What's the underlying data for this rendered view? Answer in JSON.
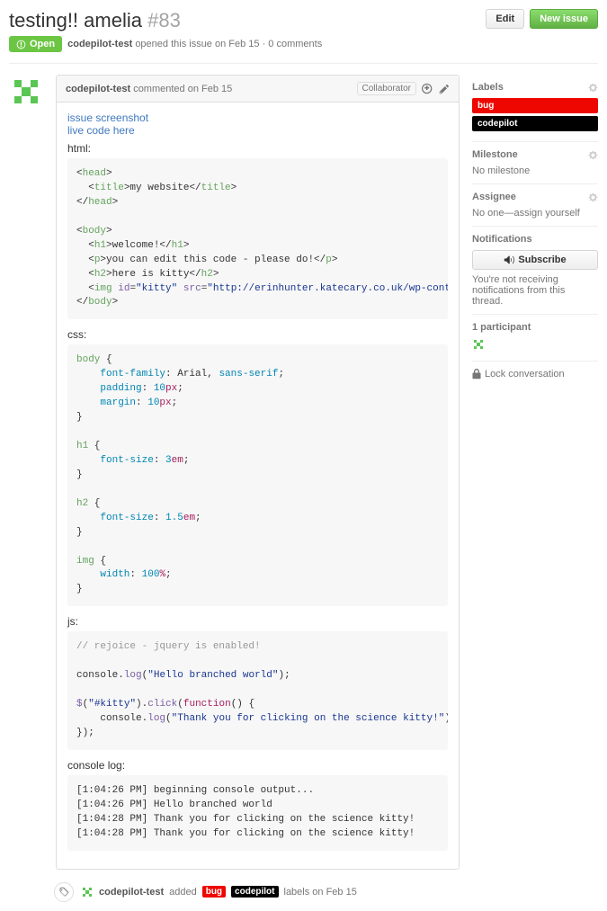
{
  "header": {
    "title": "testing!! amelia",
    "number": "#83",
    "edit": "Edit",
    "new_issue": "New issue",
    "state": "Open",
    "author": "codepilot-test",
    "opened_text": "opened this issue on Feb 15 · 0 comments"
  },
  "comment": {
    "author": "codepilot-test",
    "when": "commented on Feb 15",
    "collab": "Collaborator",
    "links": {
      "screenshot": "issue screenshot",
      "livecode": "live code here"
    },
    "labels": {
      "html": "html:",
      "css": "css:",
      "js": "js:",
      "console": "console log:"
    }
  },
  "sidebar": {
    "labels_head": "Labels",
    "label_bug": "bug",
    "label_codepilot": "codepilot",
    "milestone_head": "Milestone",
    "milestone_text": "No milestone",
    "assignee_head": "Assignee",
    "assignee_text": "No one—assign yourself",
    "notif_head": "Notifications",
    "subscribe": "Subscribe",
    "notif_text": "You're not receiving notifications from this thread.",
    "participants_head": "1 participant",
    "lock": "Lock conversation"
  },
  "timeline": {
    "author": "codepilot-test",
    "added": "added",
    "suffix": "labels on Feb 15"
  }
}
